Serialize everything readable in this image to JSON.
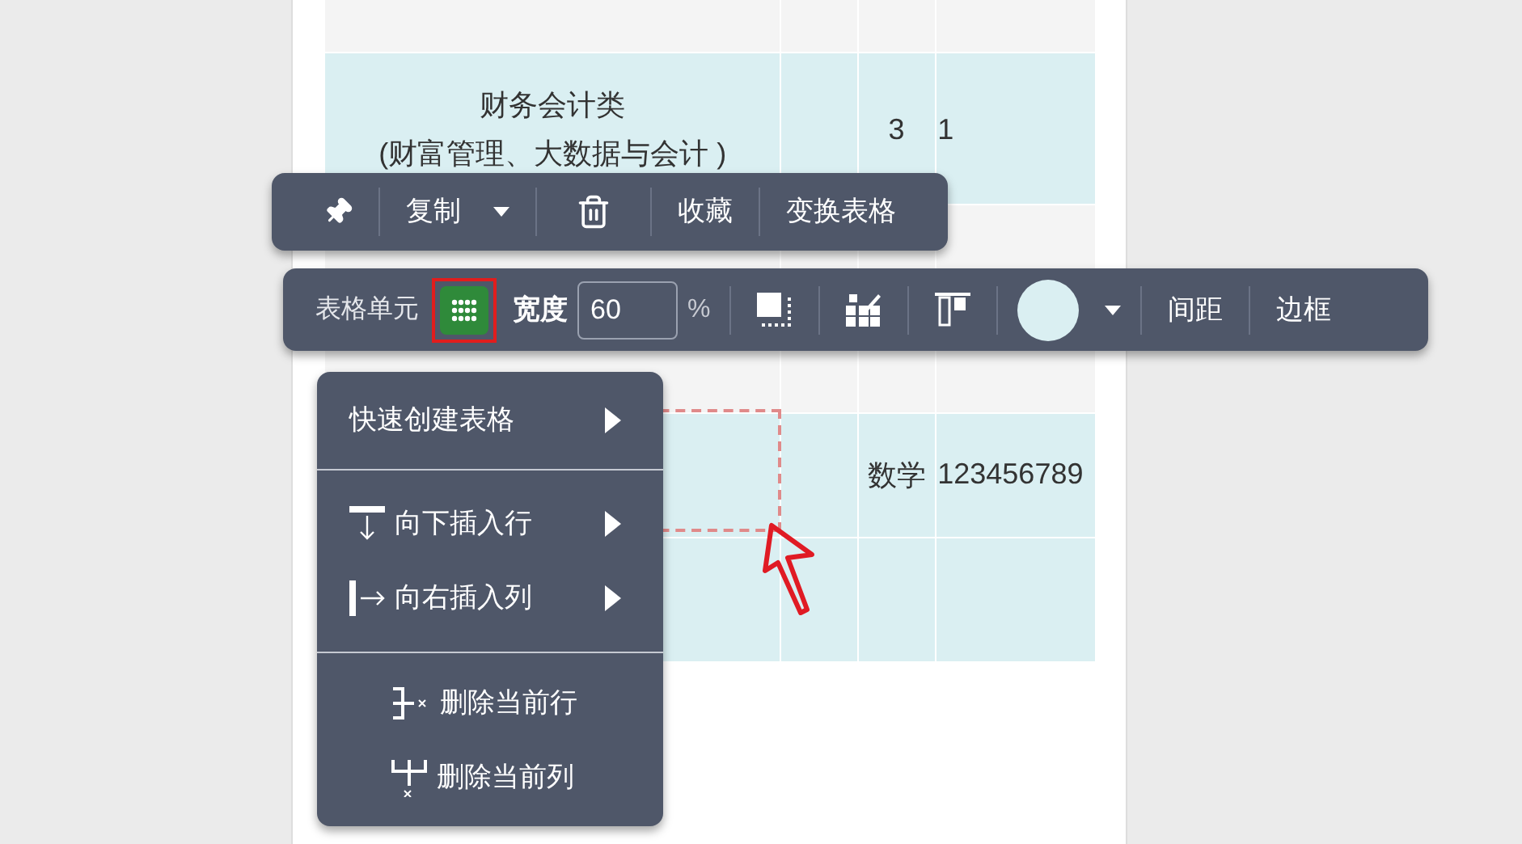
{
  "table": {
    "rows": [
      {
        "color": "#f4f4f4",
        "cells": [
          {},
          {},
          {},
          {}
        ]
      },
      {
        "color": "#daeff2",
        "cells": [
          {
            "lines": [
              "财务会计类",
              "(财富管理、大数据与会计 )"
            ]
          },
          {},
          {
            "lines": [
              "3"
            ]
          },
          {
            "lines": [
              "1"
            ]
          }
        ]
      },
      {
        "color": "#f4f4f4",
        "cells": [
          {},
          {},
          {},
          {}
        ]
      },
      {
        "color": "#daeff2",
        "cells": [
          {},
          {},
          {
            "lines": [
              "数学"
            ]
          },
          {
            "lines": [
              "123456789"
            ]
          }
        ]
      },
      {
        "color": "#daeff2",
        "cells": [
          {},
          {},
          {},
          {}
        ]
      }
    ]
  },
  "toolbar": {
    "items": [
      {
        "kind": "pin"
      },
      {
        "kind": "dropdown",
        "label": "复制"
      },
      {
        "kind": "trash"
      },
      {
        "kind": "text",
        "label": "收藏"
      },
      {
        "kind": "text",
        "label": "变换表格"
      }
    ]
  },
  "cell_toolbar": {
    "label": "表格单元",
    "grid_button": {
      "selected": true
    },
    "width_label": "宽度",
    "width_value": "60",
    "unit": "%",
    "items": [
      {
        "kind": "merge"
      },
      {
        "kind": "brush"
      },
      {
        "kind": "align"
      },
      {
        "kind": "color",
        "color": "#daeff2"
      },
      {
        "kind": "text",
        "label": "间距"
      },
      {
        "kind": "text",
        "label": "边框"
      }
    ]
  },
  "context_menu": {
    "sections": [
      {
        "items": [
          {
            "label": "快速创建表格",
            "submenu": true
          }
        ]
      },
      {
        "items": [
          {
            "label": "向下插入行",
            "submenu": true
          },
          {
            "label": "向右插入列",
            "submenu": true
          }
        ]
      },
      {
        "items": [
          {
            "label": "删除当前行",
            "submenu": false
          },
          {
            "label": "删除当前列",
            "submenu": false
          }
        ]
      }
    ]
  }
}
